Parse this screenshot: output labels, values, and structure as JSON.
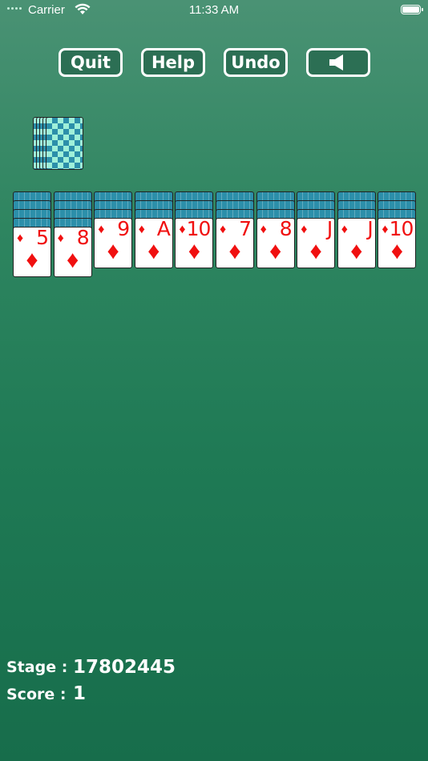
{
  "status": {
    "carrier": "Carrier",
    "time": "11:33 AM"
  },
  "toolbar": {
    "quit": "Quit",
    "help": "Help",
    "undo": "Undo",
    "sound_icon": "speaker-icon"
  },
  "stock": {
    "stacks": 5
  },
  "tableau": [
    {
      "rank": "5",
      "suit": "♦",
      "hidden": 4
    },
    {
      "rank": "8",
      "suit": "♦",
      "hidden": 4
    },
    {
      "rank": "9",
      "suit": "♦",
      "hidden": 3
    },
    {
      "rank": "A",
      "suit": "♦",
      "hidden": 3
    },
    {
      "rank": "10",
      "suit": "♦",
      "hidden": 3
    },
    {
      "rank": "7",
      "suit": "♦",
      "hidden": 3
    },
    {
      "rank": "8",
      "suit": "♦",
      "hidden": 3
    },
    {
      "rank": "J",
      "suit": "♦",
      "hidden": 3
    },
    {
      "rank": "J",
      "suit": "♦",
      "hidden": 3
    },
    {
      "rank": "10",
      "suit": "♦",
      "hidden": 3
    }
  ],
  "info": {
    "stage_label": "Stage :",
    "stage_value": "17802445",
    "score_label": "Score :",
    "score_value": "1"
  },
  "colors": {
    "felt": "#1f7a55",
    "card_red": "#f01010",
    "back_teal": "#2c8faa",
    "back_mint": "#9ff0d9"
  }
}
